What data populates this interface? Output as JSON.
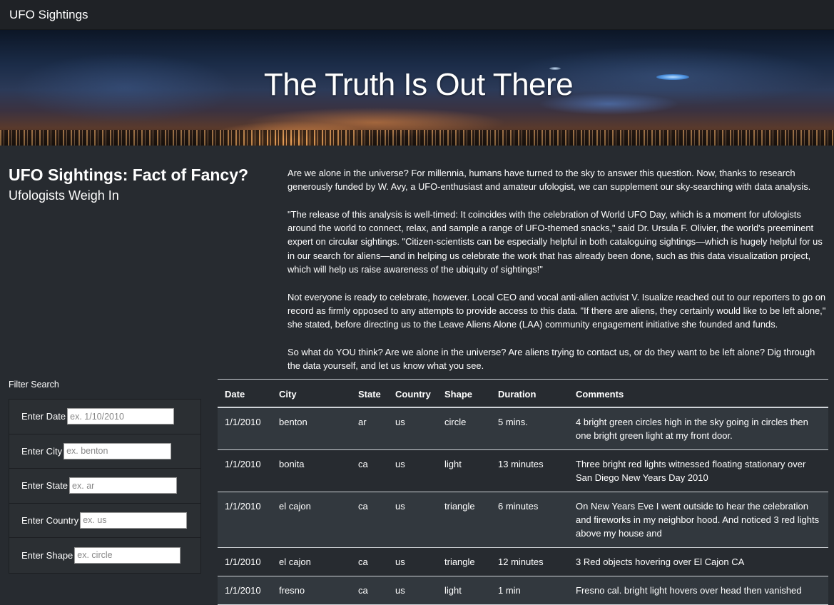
{
  "navbar": {
    "brand": "UFO Sightings"
  },
  "hero": {
    "title": "The Truth Is Out There"
  },
  "intro": {
    "heading": "UFO Sightings: Fact of Fancy?",
    "subheading": "Ufologists Weigh In",
    "paragraphs": [
      "Are we alone in the universe? For millennia, humans have turned to the sky to answer this question. Now, thanks to research generously funded by W. Avy, a UFO-enthusiast and amateur ufologist, we can supplement our sky-searching with data analysis.",
      "\"The release of this analysis is well-timed: It coincides with the celebration of World UFO Day, which is a moment for ufologists around the world to connect, relax, and sample a range of UFO-themed snacks,\" said Dr. Ursula F. Olivier, the world's preeminent expert on circular sightings. \"Citizen-scientists can be especially helpful in both cataloguing sightings—which is hugely helpful for us in our search for aliens—and in helping us celebrate the work that has already been done, such as this data visualization project, which will help us raise awareness of the ubiquity of sightings!\"",
      "Not everyone is ready to celebrate, however. Local CEO and vocal anti-alien activist V. Isualize reached out to our reporters to go on record as firmly opposed to any attempts to provide access to this data. \"If there are aliens, they certainly would like to be left alone,\" she stated, before directing us to the Leave Aliens Alone (LAA) community engagement initiative she founded and funds.",
      "So what do YOU think? Are we alone in the universe? Are aliens trying to contact us, or do they want to be left alone? Dig through the data yourself, and let us know what you see."
    ]
  },
  "filters": {
    "title": "Filter Search",
    "items": [
      {
        "label": "Enter Date",
        "placeholder": "ex. 1/10/2010",
        "value": ""
      },
      {
        "label": "Enter City",
        "placeholder": "ex. benton",
        "value": ""
      },
      {
        "label": "Enter State",
        "placeholder": "ex. ar",
        "value": ""
      },
      {
        "label": "Enter Country",
        "placeholder": "ex. us",
        "value": ""
      },
      {
        "label": "Enter Shape",
        "placeholder": "ex. circle",
        "value": ""
      }
    ]
  },
  "table": {
    "headers": [
      "Date",
      "City",
      "State",
      "Country",
      "Shape",
      "Duration",
      "Comments"
    ],
    "rows": [
      [
        "1/1/2010",
        "benton",
        "ar",
        "us",
        "circle",
        "5 mins.",
        "4 bright green circles high in the sky going in circles then one bright green light at my front door."
      ],
      [
        "1/1/2010",
        "bonita",
        "ca",
        "us",
        "light",
        "13 minutes",
        "Three bright red lights witnessed floating stationary over San Diego New Years Day 2010"
      ],
      [
        "1/1/2010",
        "el cajon",
        "ca",
        "us",
        "triangle",
        "6 minutes",
        "On New Years Eve I went outside to hear the celebration and fireworks in my neighbor hood. And noticed 3 red lights above my house and"
      ],
      [
        "1/1/2010",
        "el cajon",
        "ca",
        "us",
        "triangle",
        "12 minutes",
        "3 Red objects hovering over El Cajon CA"
      ],
      [
        "1/1/2010",
        "fresno",
        "ca",
        "us",
        "light",
        "1 min",
        "Fresno cal. bright light hovers over head then vanished"
      ]
    ]
  }
}
